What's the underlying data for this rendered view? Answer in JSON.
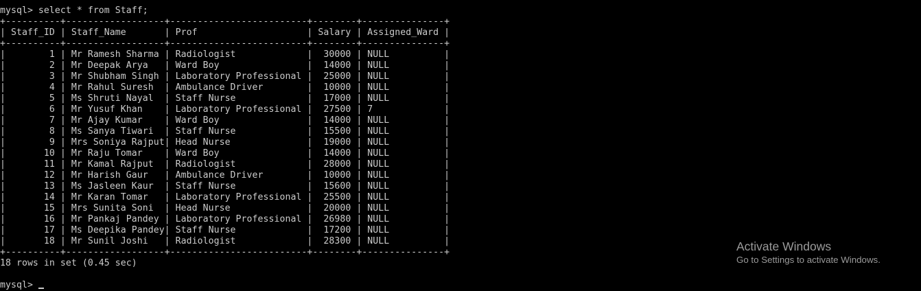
{
  "terminal": {
    "command_prompt": "mysql> select * from Staff;",
    "table_lines": [
      "+----------+------------------+-------------------------+--------+---------------+",
      "| Staff_ID | Staff_Name       | Prof                    | Salary | Assigned_Ward |",
      "+----------+------------------+-------------------------+--------+---------------+",
      "|        1 | Mr Ramesh Sharma | Radiologist             |  30000 | NULL          |",
      "|        2 | Mr Deepak Arya   | Ward Boy                |  14000 | NULL          |",
      "|        3 | Mr Shubham Singh | Laboratory Professional |  25000 | NULL          |",
      "|        4 | Mr Rahul Suresh  | Ambulance Driver        |  10000 | NULL          |",
      "|        5 | Ms Shruti Nayal  | Staff Nurse             |  17000 | NULL          |",
      "|        6 | Mr Yusuf Khan    | Laboratory Professional |  27500 | 7             |",
      "|        7 | Mr Ajay Kumar    | Ward Boy                |  14000 | NULL          |",
      "|        8 | Ms Sanya Tiwari  | Staff Nurse             |  15500 | NULL          |",
      "|        9 | Mrs Soniya Rajput| Head Nurse              |  19000 | NULL          |",
      "|       10 | Mr Raju Tomar    | Ward Boy                |  14000 | NULL          |",
      "|       11 | Mr Kamal Rajput  | Radiologist             |  28000 | NULL          |",
      "|       12 | Mr Harish Gaur   | Ambulance Driver        |  10000 | NULL          |",
      "|       13 | Ms Jasleen Kaur  | Staff Nurse             |  15600 | NULL          |",
      "|       14 | Mr Karan Tomar   | Laboratory Professional |  25500 | NULL          |",
      "|       15 | Mrs Sunita Soni  | Head Nurse              |  20000 | NULL          |",
      "|       16 | Mr Pankaj Pandey | Laboratory Professional |  26980 | NULL          |",
      "|       17 | Ms Deepika Pandey| Staff Nurse             |  17200 | NULL          |",
      "|       18 | Mr Sunil Joshi   | Radiologist             |  28300 | NULL          |",
      "+----------+------------------+-------------------------+--------+---------------+"
    ],
    "result_summary": "18 rows in set (0.45 sec)",
    "next_prompt": "mysql> "
  },
  "watermark": {
    "title": "Activate Windows",
    "subtitle": "Go to Settings to activate Windows."
  },
  "colors": {
    "background": "#000000",
    "text": "#cccccc",
    "watermark": "#9a9a9a"
  }
}
